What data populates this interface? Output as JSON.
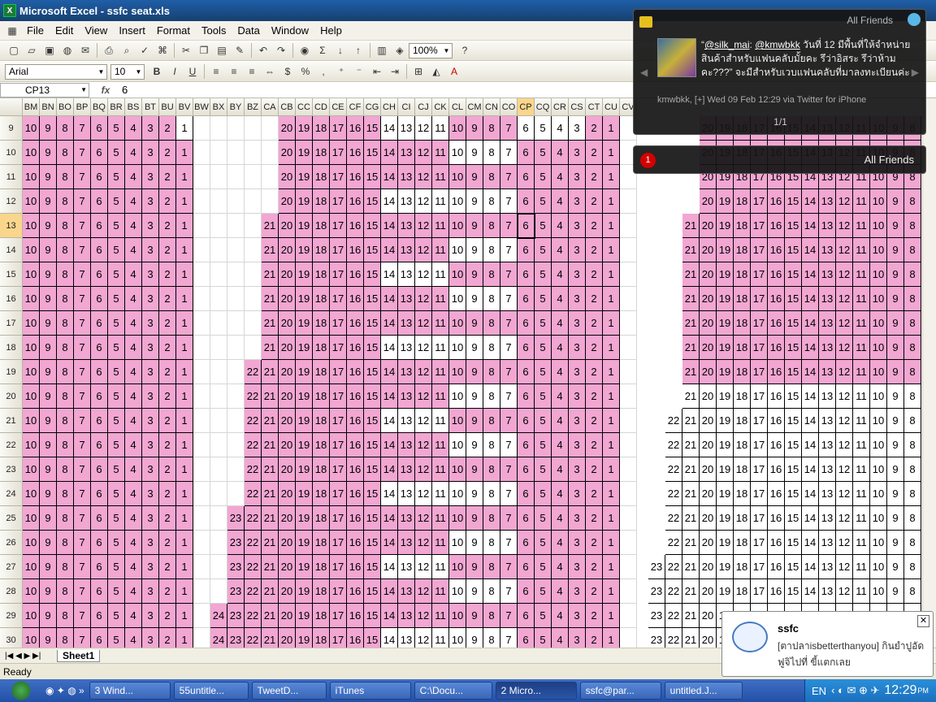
{
  "window": {
    "title": "Microsoft Excel - ssfc seat.xls"
  },
  "menu": [
    "File",
    "Edit",
    "View",
    "Insert",
    "Format",
    "Tools",
    "Data",
    "Window",
    "Help"
  ],
  "toolbar": {
    "zoom": "100%",
    "font": "Arial",
    "size": "10"
  },
  "formula": {
    "cell": "CP13",
    "fx": "fx",
    "value": "6"
  },
  "columns": [
    "BM",
    "BN",
    "BO",
    "BP",
    "BQ",
    "BR",
    "BS",
    "BT",
    "BU",
    "BV",
    "BW",
    "BX",
    "BY",
    "BZ",
    "CA",
    "CB",
    "CC",
    "CD",
    "CE",
    "CF",
    "CG",
    "CH",
    "CI",
    "CJ",
    "CK",
    "CL",
    "CM",
    "CN",
    "CO",
    "CP",
    "CQ",
    "CR",
    "CS",
    "CT",
    "CU",
    "CV"
  ],
  "rows": [
    {
      "n": "9",
      "cells": "10,9,8,7,6,5,4,3,2,1|20,19,18,17,16,15,14,13,12,11,10,9,8,7,6,5,4,3,2,1",
      "lead": 0,
      "pat": "p10w1|p8w4p4w2p2"
    },
    {
      "n": "10",
      "cells": "",
      "lead": 0
    },
    {
      "n": "11",
      "cells": "",
      "lead": 0
    },
    {
      "n": "12",
      "cells": "",
      "lead": 0
    },
    {
      "n": "13",
      "cells": "",
      "lead": 1
    },
    {
      "n": "14",
      "cells": "",
      "lead": 1
    },
    {
      "n": "15",
      "cells": "",
      "lead": 1
    },
    {
      "n": "16",
      "cells": "",
      "lead": 1
    },
    {
      "n": "17",
      "cells": "",
      "lead": 1
    },
    {
      "n": "18",
      "cells": "",
      "lead": 1
    },
    {
      "n": "19",
      "cells": "",
      "lead": 2
    },
    {
      "n": "20",
      "cells": "",
      "lead": 2
    },
    {
      "n": "21",
      "cells": "",
      "lead": 2
    },
    {
      "n": "22",
      "cells": "",
      "lead": 2
    },
    {
      "n": "23",
      "cells": "",
      "lead": 2
    },
    {
      "n": "24",
      "cells": "",
      "lead": 2
    },
    {
      "n": "25",
      "cells": "",
      "lead": 3
    },
    {
      "n": "26",
      "cells": "",
      "lead": 3
    },
    {
      "n": "27",
      "cells": "",
      "lead": 3
    },
    {
      "n": "28",
      "cells": "",
      "lead": 3
    },
    {
      "n": "29",
      "cells": "",
      "lead": 4
    },
    {
      "n": "30",
      "cells": "",
      "lead": 4
    }
  ],
  "sheet": {
    "tab": "Sheet1",
    "status": "Ready"
  },
  "tweet": {
    "group": "All Friends",
    "at1": "@silk_mai",
    "at2": "@kmwbkk",
    "text": "วันที่ 12 มีพื้นที่ให้จำหน่ายสินค้าสำหรับแฟนคลับมั้ยคะ รึว่าอิสระ รึว่าห้ามคะ???” จะมีสำหรับเวบแฟนคลับที่มาลงทะเบียนค่ะ",
    "meta": "kmwbkk, [+] Wed 09 Feb 12:29 via Twitter for iPhone",
    "page": "1/1",
    "badge": "1",
    "friends": "All Friends"
  },
  "balloon": {
    "title": "ssfc",
    "body": "[ตาปลาisbetterthanyou] กินยำปูอัด ฟูจิไปที่ ขี้แตกเลย"
  },
  "taskbar": [
    "3 Wind...",
    "55untitle...",
    "TweetD...",
    "iTunes",
    "C:\\Docu...",
    "2 Micro...",
    "ssfc@par...",
    "untitled.J..."
  ],
  "tray": {
    "lang": "EN",
    "time": "12:29",
    "ampm": "PM"
  }
}
